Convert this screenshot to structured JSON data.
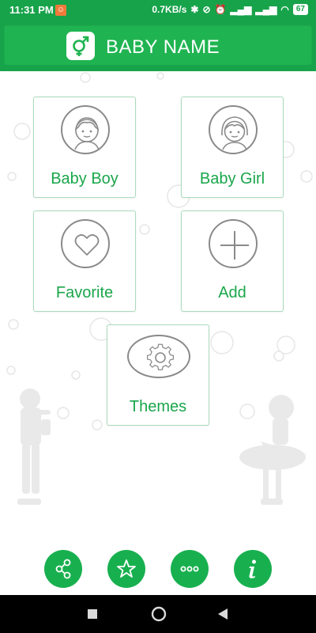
{
  "status_bar": {
    "time": "11:31 PM",
    "speed": "0.7KB/s",
    "battery": "67"
  },
  "header": {
    "title": "BABY NAME",
    "logo_icon": "gender-symbol-icon"
  },
  "tiles": [
    {
      "label": "Baby Boy",
      "icon": "boy-face-icon"
    },
    {
      "label": "Baby Girl",
      "icon": "girl-face-icon"
    },
    {
      "label": "Favorite",
      "icon": "heart-icon"
    },
    {
      "label": "Add",
      "icon": "plus-icon"
    },
    {
      "label": "Themes",
      "icon": "gear-icon"
    }
  ],
  "bottom_actions": [
    {
      "icon": "share-icon"
    },
    {
      "icon": "star-icon"
    },
    {
      "icon": "more-icon"
    },
    {
      "icon": "info-icon"
    }
  ],
  "colors": {
    "brand_green": "#17a34a",
    "label_green": "#1aa64b",
    "fab_green": "#18b04f"
  }
}
